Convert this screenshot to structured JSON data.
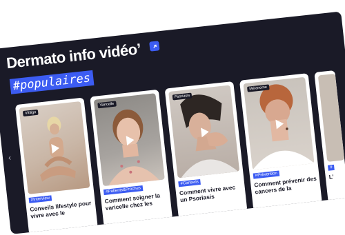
{
  "section": {
    "title": "Dermato info vidéo’",
    "hashtag": "#populaires"
  },
  "cards": [
    {
      "chip": "Vitiligo",
      "category": "#Interview",
      "title": "Conseils lifestyle pour vivre avec le"
    },
    {
      "chip": "Varicelle",
      "category": "#Patients&Proches",
      "title": "Comment soigner la varicelle chez les"
    },
    {
      "chip": "Psoriasis",
      "category": "#Conseils",
      "title": "Comment vivre avec un Psoriasis"
    },
    {
      "chip": "Mélanome",
      "category": "#Prévention",
      "title": "Comment prévenir des cancers de la"
    },
    {
      "chip": "",
      "category": "#",
      "title": "L’"
    }
  ],
  "controls": {
    "prev_arrow": "‹"
  },
  "colors": {
    "panel": "#1a1a27",
    "accent": "#3c5cf2"
  },
  "icons": [
    "external-link-icon",
    "play-icon",
    "chevron-left-icon"
  ]
}
